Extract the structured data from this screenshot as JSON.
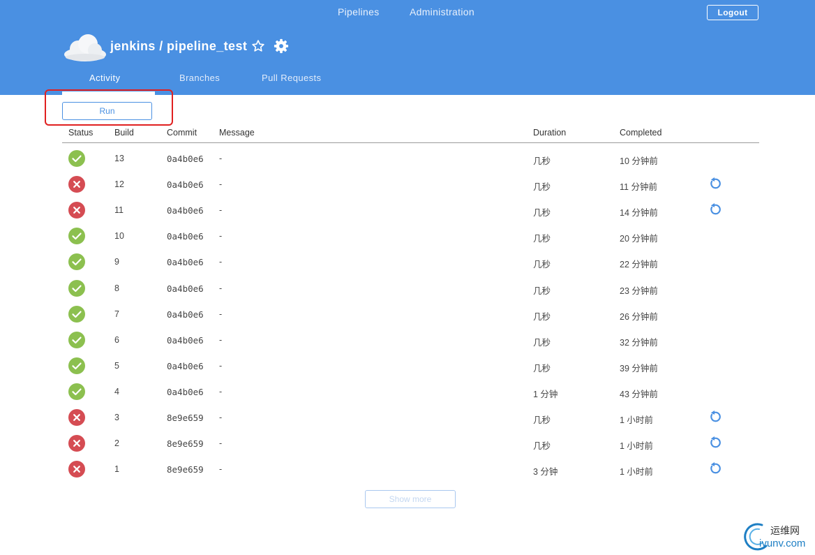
{
  "topnav": {
    "pipelines": "Pipelines",
    "administration": "Administration",
    "logout": "Logout"
  },
  "header": {
    "title": "jenkins / pipeline_test"
  },
  "tabs": {
    "activity": "Activity",
    "branches": "Branches",
    "pull_requests": "Pull Requests"
  },
  "actions": {
    "run": "Run",
    "show_more": "Show more"
  },
  "table": {
    "headers": {
      "status": "Status",
      "build": "Build",
      "commit": "Commit",
      "message": "Message",
      "duration": "Duration",
      "completed": "Completed"
    },
    "rows": [
      {
        "status": "success",
        "build": "13",
        "commit": "0a4b0e6",
        "message": "-",
        "duration": "几秒",
        "completed": "10 分钟前",
        "replay": false
      },
      {
        "status": "failure",
        "build": "12",
        "commit": "0a4b0e6",
        "message": "-",
        "duration": "几秒",
        "completed": "11 分钟前",
        "replay": true
      },
      {
        "status": "failure",
        "build": "11",
        "commit": "0a4b0e6",
        "message": "-",
        "duration": "几秒",
        "completed": "14 分钟前",
        "replay": true
      },
      {
        "status": "success",
        "build": "10",
        "commit": "0a4b0e6",
        "message": "-",
        "duration": "几秒",
        "completed": "20 分钟前",
        "replay": false
      },
      {
        "status": "success",
        "build": "9",
        "commit": "0a4b0e6",
        "message": "-",
        "duration": "几秒",
        "completed": "22 分钟前",
        "replay": false
      },
      {
        "status": "success",
        "build": "8",
        "commit": "0a4b0e6",
        "message": "-",
        "duration": "几秒",
        "completed": "23 分钟前",
        "replay": false
      },
      {
        "status": "success",
        "build": "7",
        "commit": "0a4b0e6",
        "message": "-",
        "duration": "几秒",
        "completed": "26 分钟前",
        "replay": false
      },
      {
        "status": "success",
        "build": "6",
        "commit": "0a4b0e6",
        "message": "-",
        "duration": "几秒",
        "completed": "32 分钟前",
        "replay": false
      },
      {
        "status": "success",
        "build": "5",
        "commit": "0a4b0e6",
        "message": "-",
        "duration": "几秒",
        "completed": "39 分钟前",
        "replay": false
      },
      {
        "status": "success",
        "build": "4",
        "commit": "0a4b0e6",
        "message": "-",
        "duration": "1 分钟",
        "completed": "43 分钟前",
        "replay": false
      },
      {
        "status": "failure",
        "build": "3",
        "commit": "8e9e659",
        "message": "-",
        "duration": "几秒",
        "completed": "1 小时前",
        "replay": true
      },
      {
        "status": "failure",
        "build": "2",
        "commit": "8e9e659",
        "message": "-",
        "duration": "几秒",
        "completed": "1 小时前",
        "replay": true
      },
      {
        "status": "failure",
        "build": "1",
        "commit": "8e9e659",
        "message": "-",
        "duration": "3 分钟",
        "completed": "1 小时前",
        "replay": true
      }
    ]
  },
  "watermark": {
    "cn": "运维网",
    "en": "iyunv.com"
  },
  "colors": {
    "header": "#4a90e2",
    "success": "#8cc04f",
    "failure": "#d54c53",
    "accent": "#4a90e2",
    "highlight": "#e02020"
  },
  "icons": {
    "logo": "cloud-icon",
    "favorite": "star-icon",
    "settings": "gear-icon",
    "success": "check-circle-icon",
    "failure": "x-circle-icon",
    "replay": "replay-icon"
  }
}
